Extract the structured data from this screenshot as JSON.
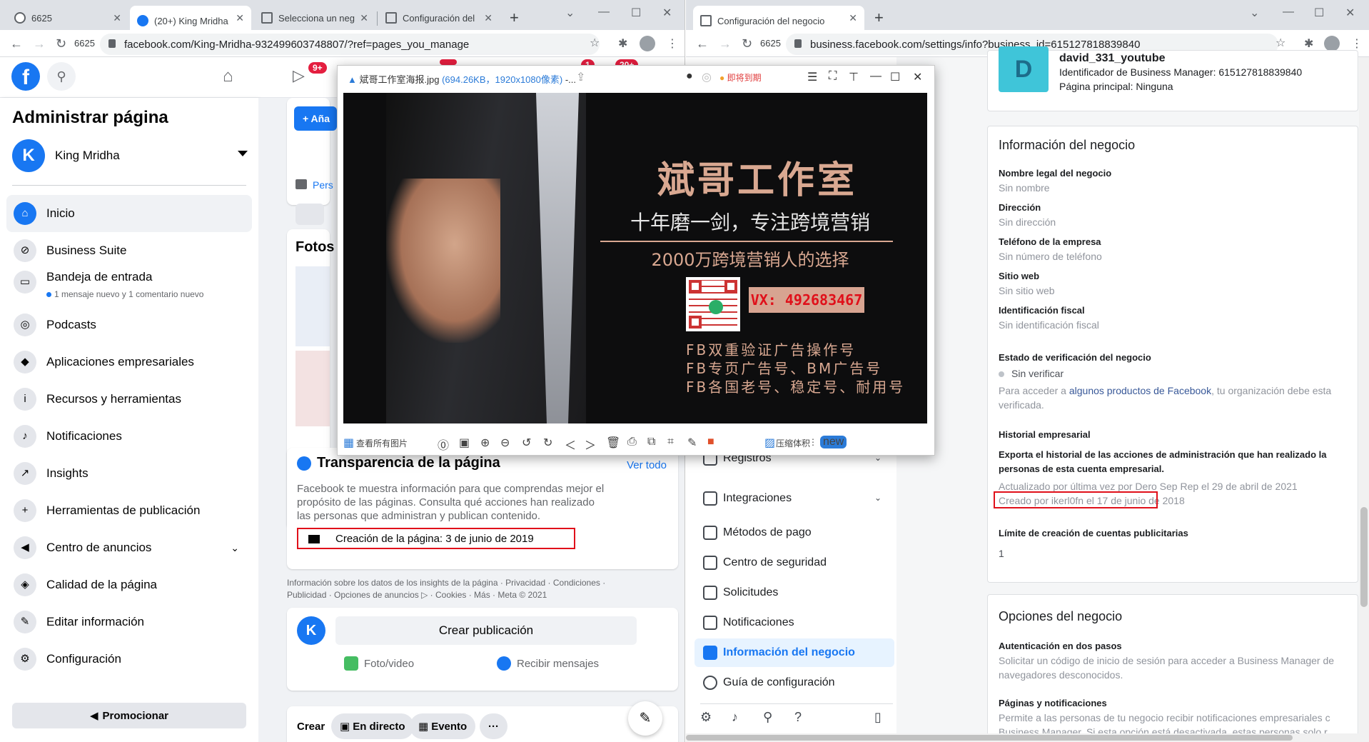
{
  "left_browser": {
    "tabs": [
      {
        "label": "6625"
      },
      {
        "label": "(20+) King Mridha"
      },
      {
        "label": "Selecciona un neg"
      },
      {
        "label": "Configuración del"
      }
    ],
    "reload_label": "6625",
    "url": "facebook.com/King-Mridha-932499603748807/?ref=pages_you_manage"
  },
  "right_browser": {
    "tabs": [
      {
        "label": "Configuración del negocio"
      }
    ],
    "reload_label": "6625",
    "url": "business.facebook.com/settings/info?business_id=615127818839840"
  },
  "fb": {
    "badges": {
      "watch": "9+",
      "b1": "1",
      "b2": "20+"
    },
    "sidebar": {
      "title": "Administrar página",
      "page_name": "King Mridha",
      "avatar_letter": "K",
      "items": [
        {
          "label": "Inicio",
          "icon": "home-icon"
        },
        {
          "label": "Business Suite",
          "icon": "business-suite-icon"
        },
        {
          "label": "Bandeja de entrada",
          "icon": "inbox-icon",
          "sub": "1 mensaje nuevo y 1 comentario nuevo"
        },
        {
          "label": "Podcasts",
          "icon": "podcast-icon"
        },
        {
          "label": "Aplicaciones empresariales",
          "icon": "box-icon"
        },
        {
          "label": "Recursos y herramientas",
          "icon": "info-icon"
        },
        {
          "label": "Notificaciones",
          "icon": "bell-icon"
        },
        {
          "label": "Insights",
          "icon": "chart-icon"
        },
        {
          "label": "Herramientas de publicación",
          "icon": "plus-square-icon"
        },
        {
          "label": "Centro de anuncios",
          "icon": "megaphone-icon"
        },
        {
          "label": "Calidad de la página",
          "icon": "shield-icon"
        },
        {
          "label": "Editar información",
          "icon": "pencil-icon"
        },
        {
          "label": "Configuración",
          "icon": "gear-icon"
        }
      ],
      "promote": "Promocionar"
    },
    "main": {
      "add_button": "+ Aña",
      "pers_label": "Pers",
      "fotos": "Fotos",
      "transparency": {
        "title": "Transparencia de la página",
        "see_all": "Ver todo",
        "desc": "Facebook te muestra información para que comprendas mejor el propósito de las páginas. Consulta qué acciones han realizado las personas que administran y publican contenido.",
        "creation": "Creación de la página: 3 de junio de 2019"
      },
      "footer_line1": "Información sobre los datos de los insights de la página · Privacidad · Condiciones ·",
      "footer_line2": "Publicidad · Opciones de anuncios ▷ · Cookies · Más · Meta © 2021",
      "composer": {
        "avatar_letter": "K",
        "create_post": "Crear publicación",
        "photo_video": "Foto/video",
        "receive_messages": "Recibir mensajes"
      },
      "create_row": {
        "label": "Crear",
        "live": "En directo",
        "event": "Evento",
        "more": "···"
      }
    }
  },
  "viewer": {
    "filename": "斌哥工作室海报.jpg",
    "meta": "(694.26KB，1920x1080像素)",
    "ellipsis": " -...",
    "badge": "即将到期",
    "poster": {
      "title": "斌哥工作室",
      "subtitle1": "十年磨一剑，专注跨境营销",
      "subtitle2": "2000万跨境营销人的选择",
      "vx": "VX: 492683467",
      "lines": [
        "FB双重验证广告操作号",
        "FB专页广告号、BM广告号",
        "FB各国老号、稳定号、耐用号"
      ]
    },
    "toolbar": {
      "all_images": "查看所有图片",
      "new_badge": "new",
      "compress": "压缩体积"
    }
  },
  "biz": {
    "nav": [
      {
        "label": "Registros",
        "chevron": true
      },
      {
        "label": "Integraciones",
        "chevron": true
      },
      {
        "label": "Métodos de pago"
      },
      {
        "label": "Centro de seguridad"
      },
      {
        "label": "Solicitudes"
      },
      {
        "label": "Notificaciones"
      },
      {
        "label": "Información del negocio",
        "active": true
      },
      {
        "label": "Guía de configuración"
      }
    ],
    "header": {
      "avatar_letter": "D",
      "name": "david_331_youtube",
      "id_line": "Identificador de Business Manager: 615127818839840",
      "page_line": "Página principal: Ninguna"
    },
    "info": {
      "title": "Información del negocio",
      "fields": [
        {
          "label": "Nombre legal del negocio",
          "value": "Sin nombre"
        },
        {
          "label": "Dirección",
          "value": "Sin dirección"
        },
        {
          "label": "Teléfono de la empresa",
          "value": "Sin número de teléfono"
        },
        {
          "label": "Sitio web",
          "value": "Sin sitio web"
        },
        {
          "label": "Identificación fiscal",
          "value": "Sin identificación fiscal"
        }
      ],
      "verif_label": "Estado de verificación del negocio",
      "verif_status": "Sin verificar",
      "verif_note_a": "Para acceder a ",
      "verif_note_link": "algunos productos de Facebook",
      "verif_note_b": ", tu organización debe esta",
      "verif_note_c": "verificada.",
      "history_label": "Historial empresarial",
      "history_desc1": "Exporta el historial de las acciones de administración que han realizado la",
      "history_desc2": "personas de esta cuenta empresarial.",
      "updated": "Actualizado por última vez por Dero Sep Rep el 29 de abril de 2021",
      "created": "Creado por ikerl0fn el 17 de junio de 2018",
      "ad_limit_label": "Límite de creación de cuentas publicitarias",
      "ad_limit_value": "1"
    },
    "options": {
      "title": "Opciones del negocio",
      "twofa_label": "Autenticación en dos pasos",
      "twofa_desc1": "Solicitar un código de inicio de sesión para acceder a Business Manager de",
      "twofa_desc2": "navegadores desconocidos.",
      "pages_label": "Páginas y notificaciones",
      "pages_desc1": "Permite a las personas de tu negocio recibir notificaciones empresariales c",
      "pages_desc2": "Business Manager. Si esta opción está desactivada, estas personas solo r"
    }
  }
}
